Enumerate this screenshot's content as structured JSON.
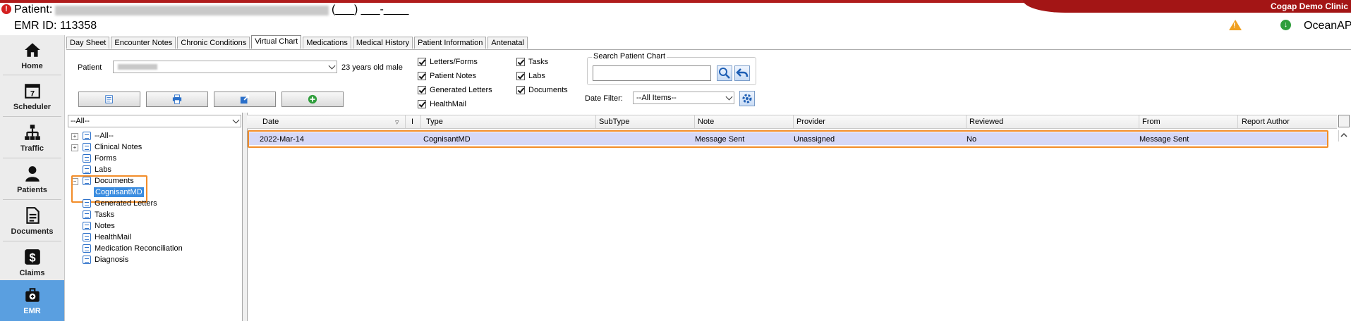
{
  "header": {
    "patient_label": "Patient:",
    "patient_tail": "(___) ___-____",
    "emr_id": "EMR ID: 113358",
    "clinic_name": "Cogap Demo Clinic",
    "app_name": "OceanAPI"
  },
  "nav": [
    {
      "label": "Home",
      "icon": "home-icon"
    },
    {
      "label": "Scheduler",
      "icon": "calendar-icon"
    },
    {
      "label": "Traffic",
      "icon": "traffic-icon"
    },
    {
      "label": "Patients",
      "icon": "person-icon"
    },
    {
      "label": "Documents",
      "icon": "document-icon"
    },
    {
      "label": "Claims",
      "icon": "dollar-icon"
    },
    {
      "label": "EMR",
      "icon": "medical-bag-icon",
      "active": true
    }
  ],
  "tabs": [
    {
      "label": "Day Sheet"
    },
    {
      "label": "Encounter Notes"
    },
    {
      "label": "Chronic Conditions"
    },
    {
      "label": "Virtual Chart",
      "active": true
    },
    {
      "label": "Medications"
    },
    {
      "label": "Medical History"
    },
    {
      "label": "Patient Information"
    },
    {
      "label": "Antenatal"
    }
  ],
  "filters": {
    "patient_label": "Patient",
    "patient_age": "23 years old male",
    "checkboxes": {
      "letters_forms": "Letters/Forms",
      "patient_notes": "Patient Notes",
      "generated_letters": "Generated Letters",
      "healthmail": "HealthMail",
      "tasks": "Tasks",
      "labs": "Labs",
      "documents": "Documents"
    },
    "search_legend": "Search Patient Chart",
    "search_value": "",
    "date_filter_label": "Date Filter:",
    "date_filter_value": "--All Items--"
  },
  "tree": {
    "filter_value": "--All--",
    "items": {
      "all": "--All--",
      "clinical_notes": "Clinical Notes",
      "forms": "Forms",
      "labs": "Labs",
      "documents": "Documents",
      "cognisantmd": "CognisantMD",
      "generated_letters": "Generated Letters",
      "tasks": "Tasks",
      "notes": "Notes",
      "healthmail": "HealthMail",
      "medication_reconciliation": "Medication Reconciliation",
      "diagnosis": "Diagnosis"
    }
  },
  "grid": {
    "columns": {
      "date": "Date",
      "i": "I",
      "type": "Type",
      "subtype": "SubType",
      "note": "Note",
      "provider": "Provider",
      "reviewed": "Reviewed",
      "from": "From",
      "report_author": "Report Author"
    },
    "rows": [
      {
        "date": "2022-Mar-14",
        "type": "CognisantMD",
        "subtype": "",
        "note": "Message Sent",
        "provider": "Unassigned",
        "reviewed": "No",
        "from": "Message Sent",
        "report_author": ""
      }
    ]
  },
  "colors": {
    "accent_blue": "#3b8de0",
    "nav_active": "#5a9fe0",
    "highlight_orange": "#f28c28",
    "selected_row": "#d6d8f7",
    "header_red": "#a31515"
  }
}
